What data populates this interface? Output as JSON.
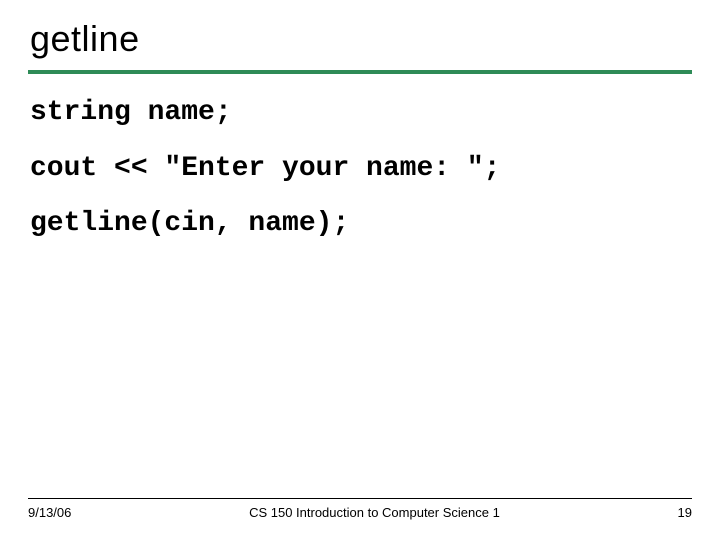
{
  "title": "getline",
  "code": {
    "line1": "string name;",
    "line2": "cout << \"Enter your name: \";",
    "line3": "getline(cin, name);"
  },
  "footer": {
    "date": "9/13/06",
    "course": "CS 150 Introduction to Computer Science 1",
    "page": "19"
  }
}
